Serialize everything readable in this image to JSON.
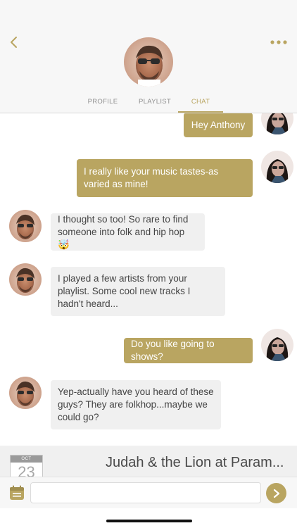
{
  "header": {
    "back_icon": "chevron-left-icon",
    "more_icon": "more-dots-icon",
    "accent_color": "#b9a561"
  },
  "tabs": [
    {
      "label": "PROFILE",
      "active": false
    },
    {
      "label": "PLAYLIST",
      "active": false
    },
    {
      "label": "CHAT",
      "active": true
    }
  ],
  "messages": [
    {
      "sender": "me",
      "text": "Hey Anthony"
    },
    {
      "sender": "me",
      "text": "I really like your music tastes-as varied as mine!"
    },
    {
      "sender": "them",
      "text": "I thought so too! So rare to find someone into folk and hip hop 🤯"
    },
    {
      "sender": "them",
      "text": "I played a few artists from your playlist. Some cool new tracks I hadn't heard..."
    },
    {
      "sender": "me",
      "text": "Do you like going to shows?"
    },
    {
      "sender": "them",
      "text": "Yep-actually have you heard of these guys? They are folkhop...maybe we could  go?"
    }
  ],
  "event": {
    "month": "OCT",
    "day": "23",
    "title": "Judah & the Lion at Param..."
  },
  "composer": {
    "value": "",
    "placeholder": "",
    "calendar_icon": "calendar-icon",
    "send_icon": "send-arrow-icon"
  }
}
